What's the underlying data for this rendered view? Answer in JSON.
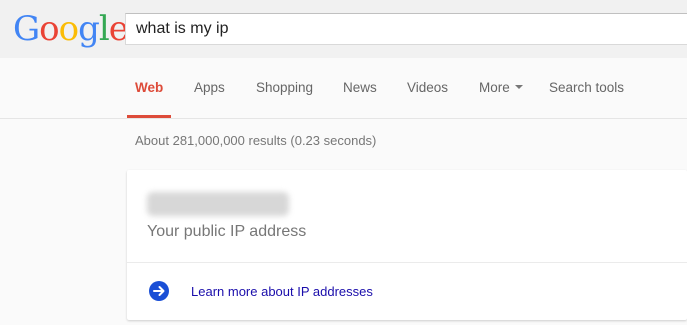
{
  "logo": {
    "letters": [
      "G",
      "o",
      "o",
      "g",
      "l",
      "e"
    ]
  },
  "search": {
    "value": "what is my ip"
  },
  "tabs": [
    {
      "label": "Web"
    },
    {
      "label": "Apps"
    },
    {
      "label": "Shopping"
    },
    {
      "label": "News"
    },
    {
      "label": "Videos"
    },
    {
      "label": "More"
    },
    {
      "label": "Search tools"
    }
  ],
  "results_stats": "About 281,000,000 results (0.23 seconds)",
  "ip_card": {
    "label": "Your public IP address",
    "learn_more": "Learn more about IP addresses"
  },
  "colors": {
    "active_tab": "#dd4b39",
    "link": "#1a0dab",
    "arrow_icon": "#1a4fd6"
  }
}
